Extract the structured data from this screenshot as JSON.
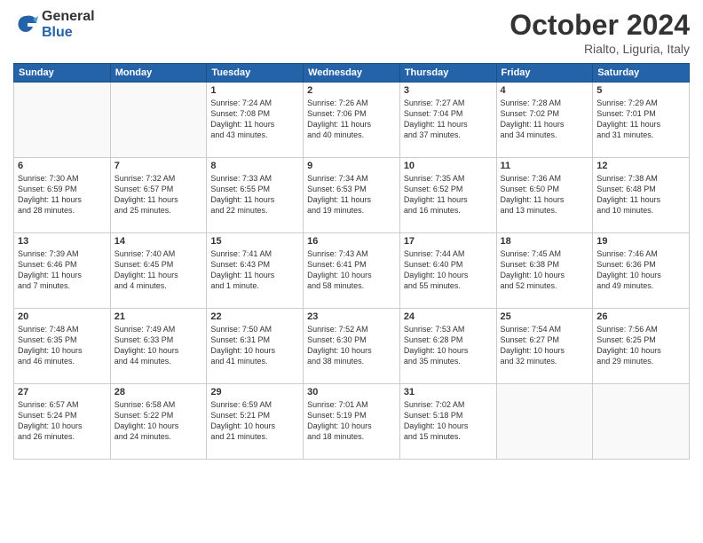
{
  "logo": {
    "general": "General",
    "blue": "Blue"
  },
  "header": {
    "month": "October 2024",
    "location": "Rialto, Liguria, Italy"
  },
  "days_of_week": [
    "Sunday",
    "Monday",
    "Tuesday",
    "Wednesday",
    "Thursday",
    "Friday",
    "Saturday"
  ],
  "weeks": [
    [
      {
        "day": "",
        "content": ""
      },
      {
        "day": "",
        "content": ""
      },
      {
        "day": "1",
        "content": "Sunrise: 7:24 AM\nSunset: 7:08 PM\nDaylight: 11 hours\nand 43 minutes."
      },
      {
        "day": "2",
        "content": "Sunrise: 7:26 AM\nSunset: 7:06 PM\nDaylight: 11 hours\nand 40 minutes."
      },
      {
        "day": "3",
        "content": "Sunrise: 7:27 AM\nSunset: 7:04 PM\nDaylight: 11 hours\nand 37 minutes."
      },
      {
        "day": "4",
        "content": "Sunrise: 7:28 AM\nSunset: 7:02 PM\nDaylight: 11 hours\nand 34 minutes."
      },
      {
        "day": "5",
        "content": "Sunrise: 7:29 AM\nSunset: 7:01 PM\nDaylight: 11 hours\nand 31 minutes."
      }
    ],
    [
      {
        "day": "6",
        "content": "Sunrise: 7:30 AM\nSunset: 6:59 PM\nDaylight: 11 hours\nand 28 minutes."
      },
      {
        "day": "7",
        "content": "Sunrise: 7:32 AM\nSunset: 6:57 PM\nDaylight: 11 hours\nand 25 minutes."
      },
      {
        "day": "8",
        "content": "Sunrise: 7:33 AM\nSunset: 6:55 PM\nDaylight: 11 hours\nand 22 minutes."
      },
      {
        "day": "9",
        "content": "Sunrise: 7:34 AM\nSunset: 6:53 PM\nDaylight: 11 hours\nand 19 minutes."
      },
      {
        "day": "10",
        "content": "Sunrise: 7:35 AM\nSunset: 6:52 PM\nDaylight: 11 hours\nand 16 minutes."
      },
      {
        "day": "11",
        "content": "Sunrise: 7:36 AM\nSunset: 6:50 PM\nDaylight: 11 hours\nand 13 minutes."
      },
      {
        "day": "12",
        "content": "Sunrise: 7:38 AM\nSunset: 6:48 PM\nDaylight: 11 hours\nand 10 minutes."
      }
    ],
    [
      {
        "day": "13",
        "content": "Sunrise: 7:39 AM\nSunset: 6:46 PM\nDaylight: 11 hours\nand 7 minutes."
      },
      {
        "day": "14",
        "content": "Sunrise: 7:40 AM\nSunset: 6:45 PM\nDaylight: 11 hours\nand 4 minutes."
      },
      {
        "day": "15",
        "content": "Sunrise: 7:41 AM\nSunset: 6:43 PM\nDaylight: 11 hours\nand 1 minute."
      },
      {
        "day": "16",
        "content": "Sunrise: 7:43 AM\nSunset: 6:41 PM\nDaylight: 10 hours\nand 58 minutes."
      },
      {
        "day": "17",
        "content": "Sunrise: 7:44 AM\nSunset: 6:40 PM\nDaylight: 10 hours\nand 55 minutes."
      },
      {
        "day": "18",
        "content": "Sunrise: 7:45 AM\nSunset: 6:38 PM\nDaylight: 10 hours\nand 52 minutes."
      },
      {
        "day": "19",
        "content": "Sunrise: 7:46 AM\nSunset: 6:36 PM\nDaylight: 10 hours\nand 49 minutes."
      }
    ],
    [
      {
        "day": "20",
        "content": "Sunrise: 7:48 AM\nSunset: 6:35 PM\nDaylight: 10 hours\nand 46 minutes."
      },
      {
        "day": "21",
        "content": "Sunrise: 7:49 AM\nSunset: 6:33 PM\nDaylight: 10 hours\nand 44 minutes."
      },
      {
        "day": "22",
        "content": "Sunrise: 7:50 AM\nSunset: 6:31 PM\nDaylight: 10 hours\nand 41 minutes."
      },
      {
        "day": "23",
        "content": "Sunrise: 7:52 AM\nSunset: 6:30 PM\nDaylight: 10 hours\nand 38 minutes."
      },
      {
        "day": "24",
        "content": "Sunrise: 7:53 AM\nSunset: 6:28 PM\nDaylight: 10 hours\nand 35 minutes."
      },
      {
        "day": "25",
        "content": "Sunrise: 7:54 AM\nSunset: 6:27 PM\nDaylight: 10 hours\nand 32 minutes."
      },
      {
        "day": "26",
        "content": "Sunrise: 7:56 AM\nSunset: 6:25 PM\nDaylight: 10 hours\nand 29 minutes."
      }
    ],
    [
      {
        "day": "27",
        "content": "Sunrise: 6:57 AM\nSunset: 5:24 PM\nDaylight: 10 hours\nand 26 minutes."
      },
      {
        "day": "28",
        "content": "Sunrise: 6:58 AM\nSunset: 5:22 PM\nDaylight: 10 hours\nand 24 minutes."
      },
      {
        "day": "29",
        "content": "Sunrise: 6:59 AM\nSunset: 5:21 PM\nDaylight: 10 hours\nand 21 minutes."
      },
      {
        "day": "30",
        "content": "Sunrise: 7:01 AM\nSunset: 5:19 PM\nDaylight: 10 hours\nand 18 minutes."
      },
      {
        "day": "31",
        "content": "Sunrise: 7:02 AM\nSunset: 5:18 PM\nDaylight: 10 hours\nand 15 minutes."
      },
      {
        "day": "",
        "content": ""
      },
      {
        "day": "",
        "content": ""
      }
    ]
  ]
}
